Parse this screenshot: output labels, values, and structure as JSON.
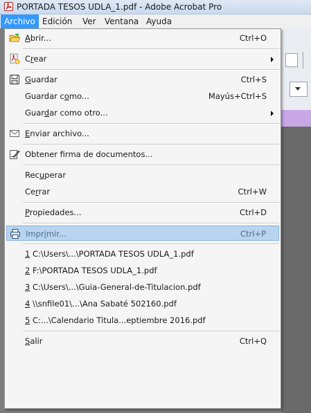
{
  "window": {
    "title": "PORTADA TESOS UDLA_1.pdf - Adobe Acrobat Pro",
    "app_icon": "acrobat-pdf-icon"
  },
  "menubar": {
    "items": [
      {
        "label": "Archivo",
        "active": true
      },
      {
        "label": "Edición"
      },
      {
        "label": "Ver"
      },
      {
        "label": "Ventana"
      },
      {
        "label": "Ayuda"
      }
    ]
  },
  "archivo_menu": {
    "abrir": {
      "pre": "",
      "key": "A",
      "post": "brir...",
      "shortcut": "Ctrl+O",
      "icon": "open-folder-icon"
    },
    "crear": {
      "pre": "C",
      "key": "r",
      "post": "ear",
      "icon": "create-pdf-icon",
      "submenu": true
    },
    "guardar": {
      "pre": "",
      "key": "G",
      "post": "uardar",
      "shortcut": "Ctrl+S",
      "icon": "save-disk-icon"
    },
    "guardar_como": {
      "pre": "Guardar c",
      "key": "o",
      "post": "mo...",
      "shortcut": "Mayús+Ctrl+S"
    },
    "guardar_como_otro": {
      "pre": "Guar",
      "key": "d",
      "post": "ar como otro...",
      "submenu": true
    },
    "enviar": {
      "pre": "",
      "key": "E",
      "post": "nviar archivo...",
      "icon": "envelope-icon"
    },
    "firma": {
      "label": "Obtener firma de documentos...",
      "icon": "signature-icon"
    },
    "recuperar": {
      "pre": "Rec",
      "key": "u",
      "post": "perar"
    },
    "cerrar": {
      "pre": "Ce",
      "key": "r",
      "post": "rar",
      "shortcut": "Ctrl+W"
    },
    "propiedades": {
      "pre": "",
      "key": "P",
      "post": "ropiedades...",
      "shortcut": "Ctrl+D"
    },
    "imprimir": {
      "pre": "Impr",
      "key": "i",
      "post": "mir...",
      "shortcut": "Ctrl+P",
      "icon": "printer-icon",
      "highlighted": true
    },
    "recent_files": [
      {
        "num": "1",
        "path": " C:\\Users\\...\\PORTADA TESOS UDLA_1.pdf"
      },
      {
        "num": "2",
        "path": " F:\\PORTADA TESOS UDLA_1.pdf"
      },
      {
        "num": "3",
        "path": " C:\\Users\\...\\Guia-General-de-Titulacion.pdf"
      },
      {
        "num": "4",
        "path": " \\\\snfile01\\...\\Ana Sabaté 502160.pdf"
      },
      {
        "num": "5",
        "path": " C:...\\Calendario Titula...eptiembre 2016.pdf"
      }
    ],
    "salir": {
      "pre": "",
      "key": "S",
      "post": "alir",
      "shortcut": "Ctrl+Q"
    }
  },
  "colors": {
    "menu_active": "#3399ff",
    "highlight": "#b8d4ef",
    "menu_bg": "#f5f5f5"
  }
}
